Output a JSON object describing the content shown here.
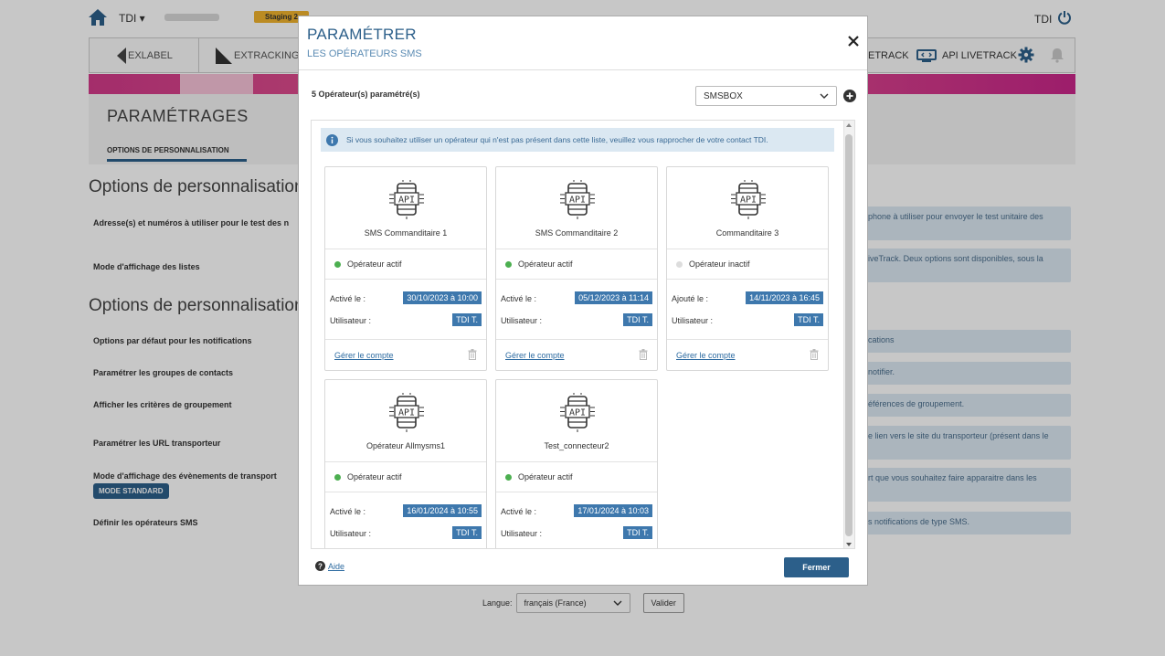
{
  "topbar": {
    "org_label": "TDI ▾",
    "staging": "Staging 2",
    "user_right": "TDI"
  },
  "apps": {
    "exlabel": "EXLABEL",
    "extracking": "EXTRACKING",
    "livetrack": "ETRACK",
    "api_livetrack": "API LIVETRACK"
  },
  "settings": {
    "title": "PARAMÉTRAGES",
    "tab": "OPTIONS DE PERSONNALISATION",
    "section1": "Options de personnalisation",
    "section2": "Options de personnalisation",
    "rows": [
      {
        "label": "Adresse(s) et numéros à utiliser pour le test des n",
        "hint": "phone à utiliser pour envoyer le test unitaire des"
      },
      {
        "label": "Mode d'affichage des listes",
        "hint": "iveTrack. Deux options sont disponibles, sous la"
      },
      {
        "label": "Options par défaut pour les notifications",
        "hint": "cations"
      },
      {
        "label": "Paramétrer les groupes de contacts",
        "hint": "notifier."
      },
      {
        "label": "Afficher les critères de groupement",
        "hint": "éférences de groupement."
      },
      {
        "label": "Paramétrer les URL transporteur",
        "hint": "e lien vers le site du transporteur (présent dans le"
      },
      {
        "label": "Mode d'affichage des évènements de transport",
        "hint": "rt que vous souhaitez faire apparaitre dans les"
      },
      {
        "label": "Définir les opérateurs SMS",
        "hint": "s notifications de type SMS."
      }
    ],
    "mode_badge": "MODE STANDARD"
  },
  "lang": {
    "label": "Langue:",
    "value": "français (France)",
    "validate": "Valider"
  },
  "modal": {
    "title": "PARAMÉTRER",
    "subtitle": "LES OPÉRATEURS SMS",
    "count": "5 Opérateur(s) paramétré(s)",
    "select_value": "SMSBOX",
    "info": "Si vous souhaitez utiliser un opérateur qui n'est pas présent dans cette liste, veuillez vous rapprocher de votre contact TDI.",
    "manage": "Gérer le compte",
    "user_label": "Utilisateur :",
    "help": "Aide",
    "close": "Fermer",
    "cards": [
      {
        "name": "SMS Commanditaire 1",
        "status": "Opérateur actif",
        "active": true,
        "date_label": "Activé le :",
        "date": "30/10/2023 à 10:00",
        "user": "TDI T."
      },
      {
        "name": "SMS Commanditaire 2",
        "status": "Opérateur actif",
        "active": true,
        "date_label": "Activé le :",
        "date": "05/12/2023 à 11:14",
        "user": "TDI T."
      },
      {
        "name": "Commanditaire 3",
        "status": "Opérateur inactif",
        "active": false,
        "date_label": "Ajouté le :",
        "date": "14/11/2023 à 16:45",
        "user": "TDI T."
      },
      {
        "name": "Opérateur Allmysms1",
        "status": "Opérateur actif",
        "active": true,
        "date_label": "Activé le :",
        "date": "16/01/2024 à 10:55",
        "user": "TDI T."
      },
      {
        "name": "Test_connecteur2",
        "status": "Opérateur actif",
        "active": true,
        "date_label": "Activé le :",
        "date": "17/01/2024 à 10:03",
        "user": "TDI T."
      }
    ]
  },
  "colors": {
    "primary": "#2c5f8a",
    "active_dot": "#4caf50",
    "inactive_dot": "#dddddd",
    "badge": "#3e78ad",
    "hint_bg": "#dbe8f2",
    "staging": "#f0b32e"
  }
}
